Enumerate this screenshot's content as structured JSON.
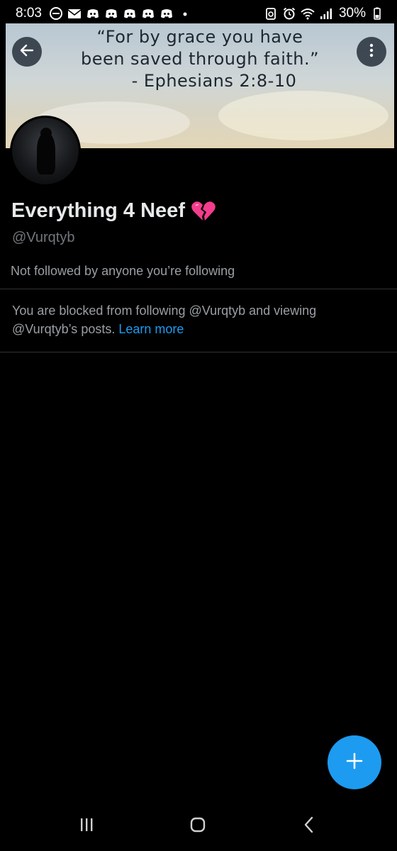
{
  "status_bar": {
    "time": "8:03",
    "battery_percent": "30%",
    "left_icons": [
      "do-not-disturb-icon",
      "mail-icon",
      "discord-icon",
      "discord-icon",
      "discord-icon",
      "discord-icon",
      "discord-icon",
      "dot-icon"
    ],
    "right_icons": [
      "sync-icon",
      "alarm-icon",
      "wifi-icon",
      "signal-icon",
      "battery-icon"
    ]
  },
  "banner": {
    "quote_line1": "“For by grace you have",
    "quote_line2": "been saved through faith.”",
    "reference": "- Ephesians 2:8-10"
  },
  "profile": {
    "display_name": "Everything 4 Neef",
    "name_emoji": "broken-heart-icon",
    "handle": "@Vurqtyb",
    "followed_by": "Not followed by anyone you’re following",
    "blocked_text": "You are blocked from following @Vurqtyb and viewing @Vurqtyb’s posts. ",
    "learn_more": "Learn more"
  },
  "colors": {
    "accent": "#1d9bf0",
    "background": "#000000",
    "primary_text": "#e7e9ea",
    "secondary_text": "#71767b",
    "divider": "#2f3336",
    "heart": "#f23d8c"
  },
  "icons": {
    "back": "arrow-left-icon",
    "more": "more-vertical-icon",
    "compose": "plus-icon",
    "nav_recents": "recent-apps-icon",
    "nav_home": "home-icon",
    "nav_back": "nav-back-icon"
  }
}
